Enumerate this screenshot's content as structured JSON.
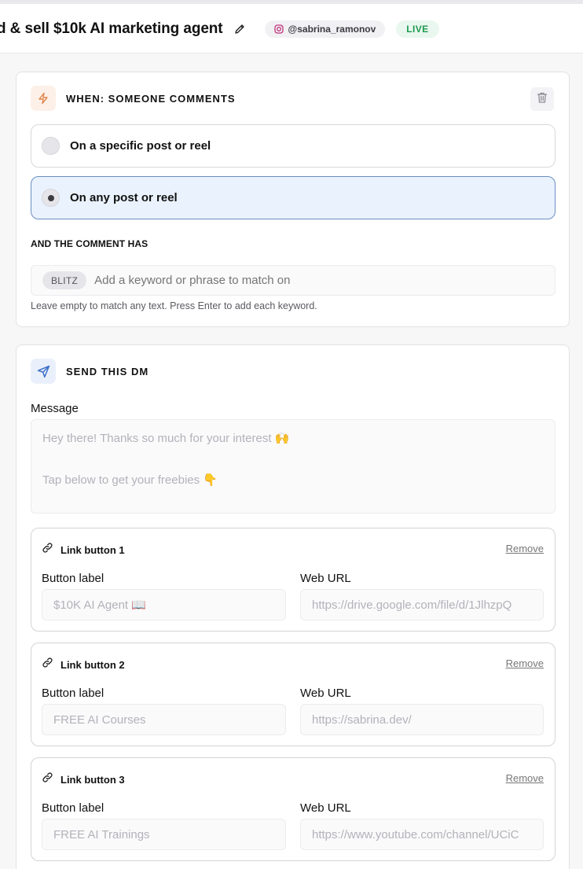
{
  "header": {
    "title": "d & sell $10k AI marketing agent",
    "handle": "@sabrina_ramonov",
    "status": "LIVE"
  },
  "trigger": {
    "section_label": "WHEN: SOMEONE COMMENTS",
    "options": [
      {
        "label": "On a specific post or reel",
        "selected": false
      },
      {
        "label": "On any post or reel",
        "selected": true
      }
    ],
    "keyword_section_label": "AND THE COMMENT HAS",
    "keywords": [
      "BLITZ"
    ],
    "keyword_placeholder": "Add a keyword or phrase to match on",
    "keyword_hint": "Leave empty to match any text. Press Enter to add each keyword."
  },
  "dm": {
    "section_label": "SEND THIS DM",
    "message_label": "Message",
    "message_line1": "Hey there! Thanks so much for your interest 🙌",
    "message_line2": "Tap below to get your freebies 👇",
    "link_buttons": [
      {
        "title": "Link button 1",
        "remove": "Remove",
        "label_heading": "Button label",
        "url_heading": "Web URL",
        "label": "$10K AI Agent 📖",
        "url": "https://drive.google.com/file/d/1JlhzpQ"
      },
      {
        "title": "Link button 2",
        "remove": "Remove",
        "label_heading": "Button label",
        "url_heading": "Web URL",
        "label": "FREE AI Courses",
        "url": "https://sabrina.dev/"
      },
      {
        "title": "Link button 3",
        "remove": "Remove",
        "label_heading": "Button label",
        "url_heading": "Web URL",
        "label": "FREE AI Trainings",
        "url": "https://www.youtube.com/channel/UCiC"
      }
    ]
  },
  "colors": {
    "accent_orange": "#e0834a",
    "accent_blue": "#3b6fc9",
    "live_green": "#1f9a4f",
    "selected_bg": "#eaf2fd"
  }
}
